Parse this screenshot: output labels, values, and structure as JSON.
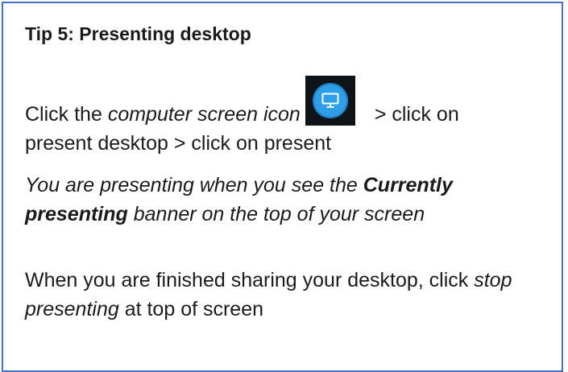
{
  "tip": {
    "title": "Tip 5:  Presenting desktop",
    "step1": {
      "pre": "Click the ",
      "icon_ref": "computer screen icon",
      "post_line1": "> click on",
      "line2": "present desktop > click on present"
    },
    "note": {
      "part1": "You are presenting when you see the ",
      "bold": "Currently presenting",
      "part2": "  banner on the top of your screen"
    },
    "finish": {
      "part1": "When you are finished sharing your desktop, click ",
      "italic": "stop presenting",
      "part2": " at top of screen"
    },
    "icon": {
      "name": "computer-screen-icon",
      "tile_color": "#0f1419",
      "circle_color": "#2f9ee8"
    }
  }
}
